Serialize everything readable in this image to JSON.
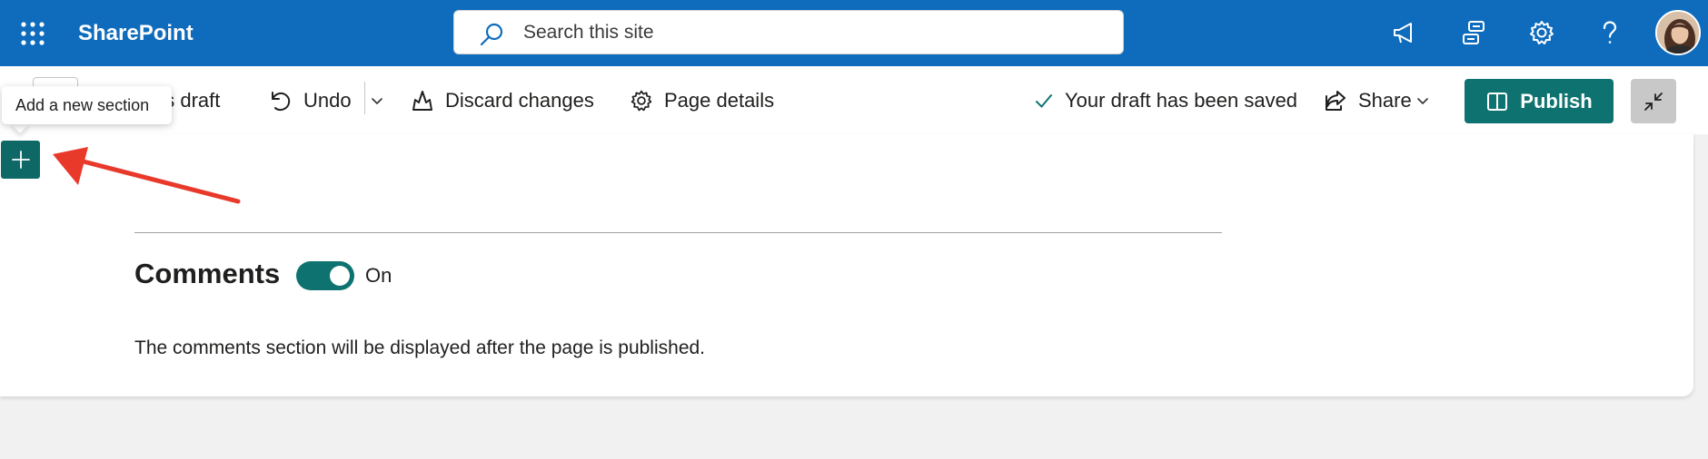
{
  "suite": {
    "app_name": "SharePoint",
    "search_placeholder": "Search this site",
    "icons": [
      "waffle-icon",
      "announcement-icon",
      "connections-icon",
      "settings-icon",
      "help-icon"
    ]
  },
  "commandbar": {
    "save_label": "Save as draft",
    "save_visible": "as draft",
    "undo_label": "Undo",
    "discard_label": "Discard changes",
    "details_label": "Page details",
    "status_text": "Your draft has been saved",
    "share_label": "Share",
    "publish_label": "Publish"
  },
  "section": {
    "tooltip": "Add a new section"
  },
  "comments": {
    "title": "Comments",
    "toggle_state": "On",
    "toggle_on": true,
    "note": "The comments section will be displayed after the page is published."
  },
  "colors": {
    "suite_bar": "#0f6cbd",
    "accent": "#0e7370",
    "annotation_arrow": "#e8392b"
  }
}
